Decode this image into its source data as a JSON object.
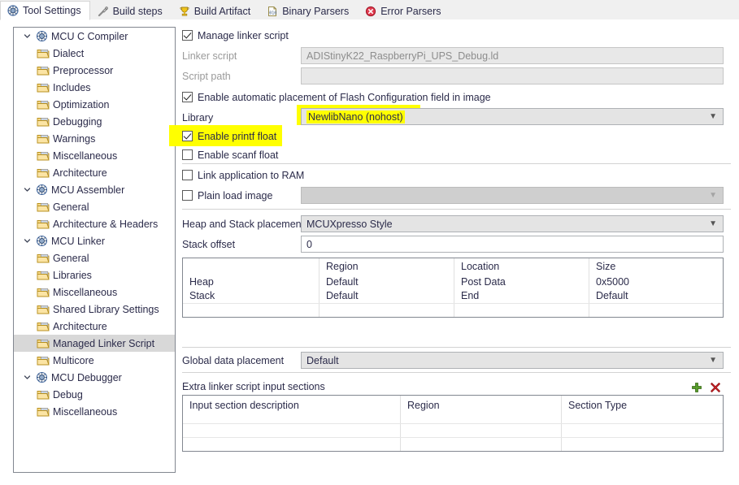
{
  "tabs": [
    {
      "label": "Tool Settings",
      "icon": "tool-settings-icon",
      "active": true
    },
    {
      "label": "Build steps",
      "icon": "build-steps-icon",
      "active": false
    },
    {
      "label": "Build Artifact",
      "icon": "build-artifact-icon",
      "active": false
    },
    {
      "label": "Binary Parsers",
      "icon": "binary-parsers-icon",
      "active": false
    },
    {
      "label": "Error Parsers",
      "icon": "error-parsers-icon",
      "active": false
    }
  ],
  "tree": [
    {
      "label": "MCU C Compiler",
      "level": 0,
      "expanded": true,
      "selected": false,
      "icon": "tool-node-icon"
    },
    {
      "label": "Dialect",
      "level": 1,
      "selected": false,
      "icon": "folder-page-icon"
    },
    {
      "label": "Preprocessor",
      "level": 1,
      "selected": false,
      "icon": "folder-page-icon"
    },
    {
      "label": "Includes",
      "level": 1,
      "selected": false,
      "icon": "folder-page-icon"
    },
    {
      "label": "Optimization",
      "level": 1,
      "selected": false,
      "icon": "folder-page-icon"
    },
    {
      "label": "Debugging",
      "level": 1,
      "selected": false,
      "icon": "folder-page-icon"
    },
    {
      "label": "Warnings",
      "level": 1,
      "selected": false,
      "icon": "folder-page-icon"
    },
    {
      "label": "Miscellaneous",
      "level": 1,
      "selected": false,
      "icon": "folder-page-icon"
    },
    {
      "label": "Architecture",
      "level": 1,
      "selected": false,
      "icon": "folder-page-icon"
    },
    {
      "label": "MCU Assembler",
      "level": 0,
      "expanded": true,
      "selected": false,
      "icon": "tool-node-icon"
    },
    {
      "label": "General",
      "level": 1,
      "selected": false,
      "icon": "folder-page-icon"
    },
    {
      "label": "Architecture & Headers",
      "level": 1,
      "selected": false,
      "icon": "folder-page-icon"
    },
    {
      "label": "MCU Linker",
      "level": 0,
      "expanded": true,
      "selected": false,
      "icon": "tool-node-icon"
    },
    {
      "label": "General",
      "level": 1,
      "selected": false,
      "icon": "folder-page-icon"
    },
    {
      "label": "Libraries",
      "level": 1,
      "selected": false,
      "icon": "folder-page-icon"
    },
    {
      "label": "Miscellaneous",
      "level": 1,
      "selected": false,
      "icon": "folder-page-icon"
    },
    {
      "label": "Shared Library Settings",
      "level": 1,
      "selected": false,
      "icon": "folder-page-icon"
    },
    {
      "label": "Architecture",
      "level": 1,
      "selected": false,
      "icon": "folder-page-icon"
    },
    {
      "label": "Managed Linker Script",
      "level": 1,
      "selected": true,
      "icon": "folder-page-icon"
    },
    {
      "label": "Multicore",
      "level": 1,
      "selected": false,
      "icon": "folder-page-icon"
    },
    {
      "label": "MCU Debugger",
      "level": 0,
      "expanded": true,
      "selected": false,
      "icon": "tool-node-icon"
    },
    {
      "label": "Debug",
      "level": 1,
      "selected": false,
      "icon": "folder-page-icon"
    },
    {
      "label": "Miscellaneous",
      "level": 1,
      "selected": false,
      "icon": "folder-page-icon"
    }
  ],
  "panel": {
    "manage_linker_script": {
      "label": "Manage linker script",
      "checked": true
    },
    "linker_script": {
      "label": "Linker script",
      "value": "ADIStinyK22_RaspberryPi_UPS_Debug.ld",
      "readonly": true
    },
    "script_path": {
      "label": "Script path",
      "value": "",
      "readonly": true
    },
    "flash_config": {
      "label": "Enable automatic placement of Flash Configuration field in image",
      "checked": true
    },
    "library": {
      "label": "Library",
      "value": "NewlibNano (nohost)",
      "highlighted": true
    },
    "printf_float": {
      "label": "Enable printf float",
      "checked": true,
      "highlighted": true
    },
    "scanf_float": {
      "label": "Enable scanf float",
      "checked": false
    },
    "link_to_ram": {
      "label": "Link application to RAM",
      "checked": false
    },
    "plain_load_image": {
      "label": "Plain load image",
      "checked": false,
      "value": "",
      "disabled": true
    },
    "heap_stack_placement": {
      "label": "Heap and Stack placement",
      "value": "MCUXpresso Style"
    },
    "stack_offset": {
      "label": "Stack offset",
      "value": "0"
    },
    "heap_stack_table": {
      "columns": [
        "",
        "Region",
        "Location",
        "Size"
      ],
      "rows": [
        [
          "Heap",
          "Default",
          "Post Data",
          "0x5000"
        ],
        [
          "Stack",
          "Default",
          "End",
          "Default"
        ]
      ]
    },
    "global_data_placement": {
      "label": "Global data placement",
      "value": "Default"
    },
    "extra_sections": {
      "label": "Extra linker script input sections",
      "add_icon": "add-icon",
      "delete_icon": "delete-icon",
      "columns": [
        "Input section description",
        "Region",
        "Section Type"
      ],
      "rows": []
    }
  },
  "colors": {
    "highlight": "#ffff00",
    "selection": "#d8d8d8",
    "text": "#2b2b4a",
    "add": "#4e9a06",
    "delete": "#cc0000"
  }
}
